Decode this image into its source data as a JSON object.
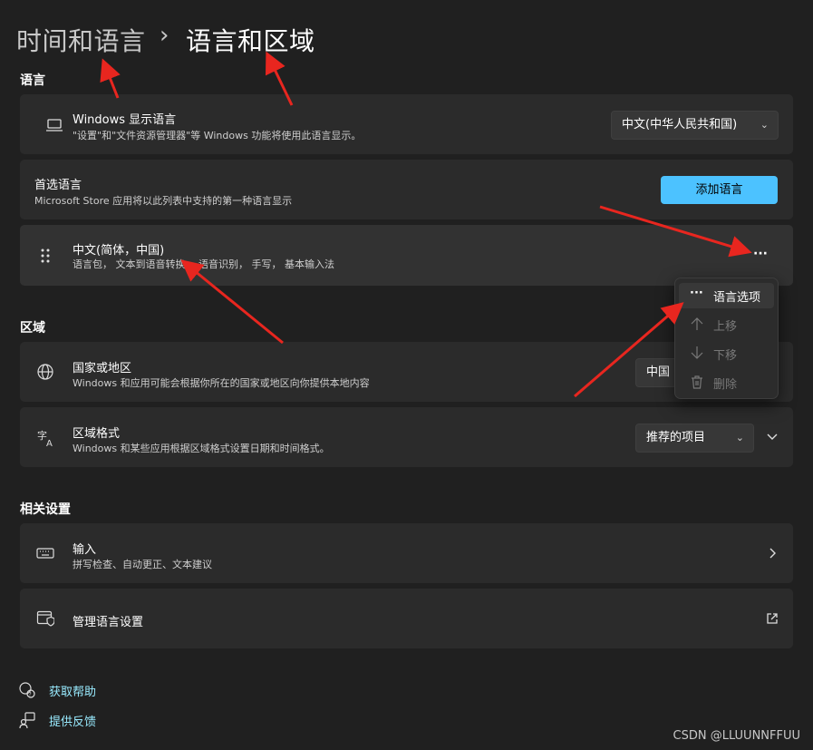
{
  "breadcrumb": {
    "parent": "时间和语言",
    "separator": "›",
    "current": "语言和区域"
  },
  "language_section": {
    "heading": "语言",
    "display_language": {
      "title": "Windows 显示语言",
      "subtitle": "\"设置\"和\"文件资源管理器\"等 Windows 功能将使用此语言显示。",
      "value": "中文(中华人民共和国)",
      "icon": "laptop-icon"
    },
    "preferred": {
      "title": "首选语言",
      "subtitle": "Microsoft Store 应用将以此列表中支持的第一种语言显示",
      "add_button": "添加语言"
    },
    "language_item": {
      "title": "中文(简体，中国)",
      "subtitle": "语言包， 文本到语音转换， 语音识别， 手写， 基本输入法",
      "more": "···"
    }
  },
  "context_menu": {
    "items": [
      {
        "label": "语言选项",
        "icon": "more-icon",
        "enabled": true
      },
      {
        "label": "上移",
        "icon": "arrow-up-icon",
        "enabled": false
      },
      {
        "label": "下移",
        "icon": "arrow-down-icon",
        "enabled": false
      },
      {
        "label": "删除",
        "icon": "trash-icon",
        "enabled": false
      }
    ]
  },
  "region_section": {
    "heading": "区域",
    "country": {
      "title": "国家或地区",
      "subtitle": "Windows 和应用可能会根据你所在的国家或地区向你提供本地内容",
      "value": "中国",
      "icon": "globe-icon"
    },
    "format": {
      "title": "区域格式",
      "subtitle": "Windows 和某些应用根据区域格式设置日期和时间格式。",
      "value": "推荐的项目",
      "icon": "language-format-icon"
    }
  },
  "related_section": {
    "heading": "相关设置",
    "typing": {
      "title": "输入",
      "subtitle": "拼写检查、自动更正、文本建议",
      "icon": "keyboard-icon"
    },
    "admin": {
      "title": "管理语言设置",
      "icon": "shield-window-icon"
    }
  },
  "footer": {
    "help": "获取帮助",
    "feedback": "提供反馈"
  },
  "watermark": "CSDN @LLUUNNFFUU",
  "colors": {
    "background": "#202020",
    "card": "#2b2b2b",
    "accent": "#4cc2ff",
    "link": "#99ebff",
    "annotation": "#e8261f"
  }
}
